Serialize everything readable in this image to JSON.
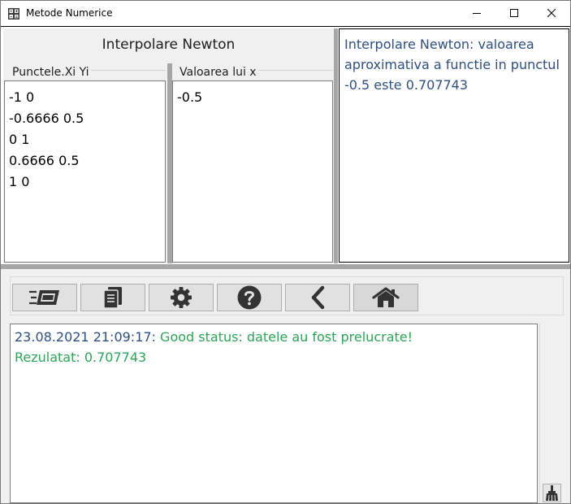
{
  "window": {
    "title": "Metode Numerice"
  },
  "interpolation": {
    "heading": "Interpolare Newton",
    "points_label": "Punctele.Xi Yi",
    "points_value": "-1 0\n-0.6666 0.5\n0 1\n0.6666 0.5\n1 0",
    "x_label": "Valoarea lui x",
    "x_value": "-0.5"
  },
  "result": {
    "text": "Interpolare Newton: valoarea aproximativa a functie in punctul -0.5 este 0.707743",
    "color": "#2e5080"
  },
  "toolbar": {
    "icons": [
      "input-form-icon",
      "document-icon",
      "gear-icon",
      "help-icon",
      "back-chevron-icon",
      "home-icon"
    ]
  },
  "log": {
    "timestamp": "23.08.2021 21:09:17:",
    "status": " Good status: datele au fost prelucrate!",
    "result_line": "Rezulatat: 0.707743",
    "timestamp_color": "#2e5080",
    "status_color": "#2ca558"
  }
}
